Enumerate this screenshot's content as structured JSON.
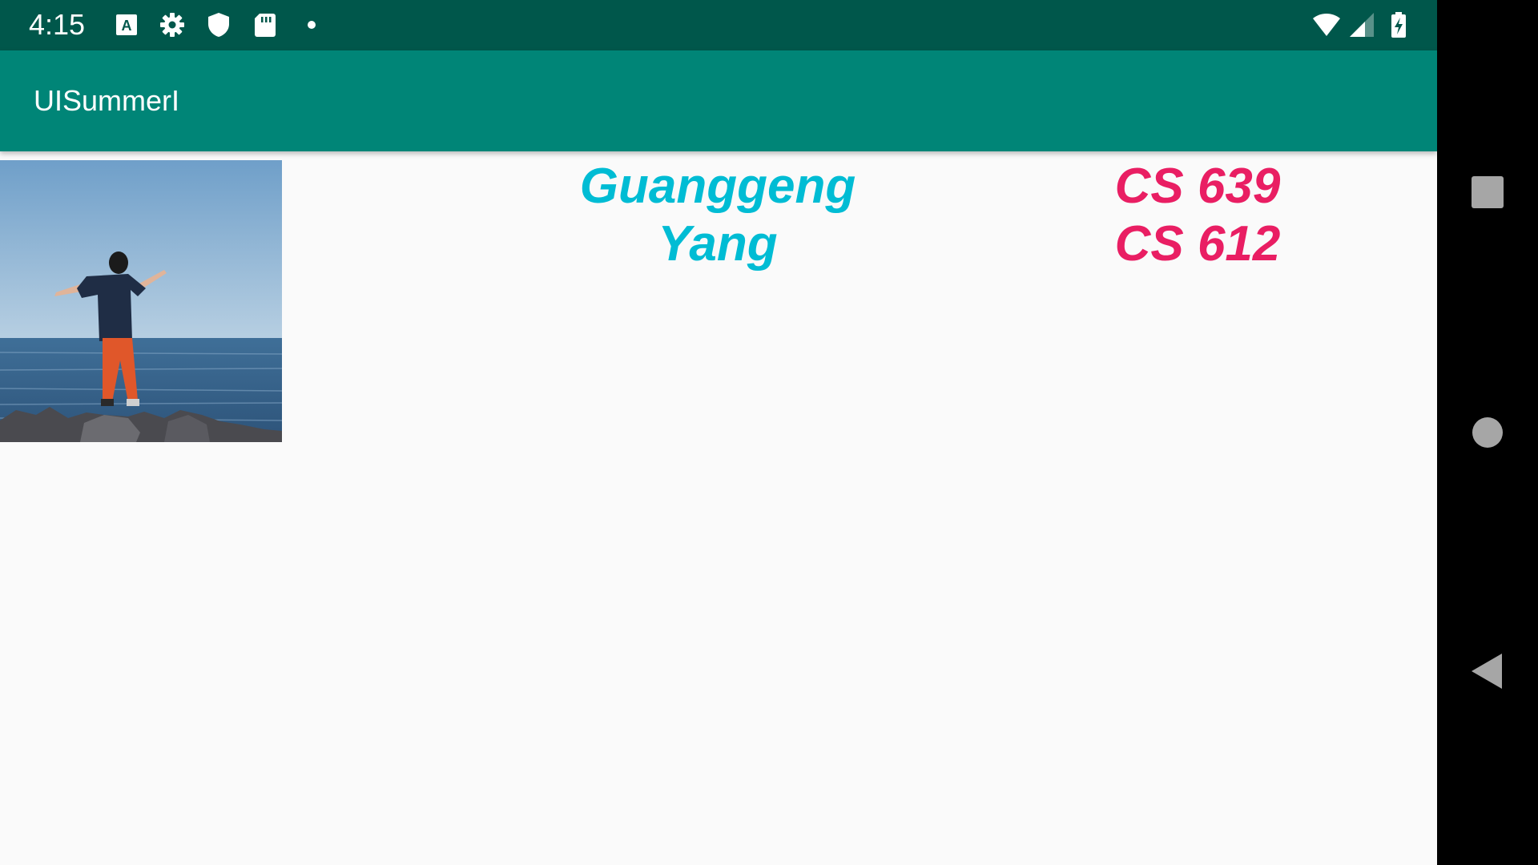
{
  "status_bar": {
    "time": "4:15",
    "left_icons": [
      "keyboard-a-icon",
      "settings-gear-icon",
      "shield-icon",
      "sd-card-icon",
      "dot-icon"
    ],
    "right_icons": [
      "wifi-icon",
      "cellular-signal-icon",
      "battery-charging-icon"
    ]
  },
  "app_bar": {
    "title": "UISummerI"
  },
  "main": {
    "photo_alt": "photo",
    "name": "Guanggeng\nYang",
    "courses": [
      "CS 639",
      "CS 612"
    ]
  },
  "nav_bar": {
    "buttons": [
      "recents-square-icon",
      "home-circle-icon",
      "back-triangle-icon"
    ]
  },
  "colors": {
    "status_bar": "#00574b",
    "app_bar": "#008577",
    "name_text": "#00bcd4",
    "course_text": "#e91e63",
    "background": "#fafafa"
  }
}
